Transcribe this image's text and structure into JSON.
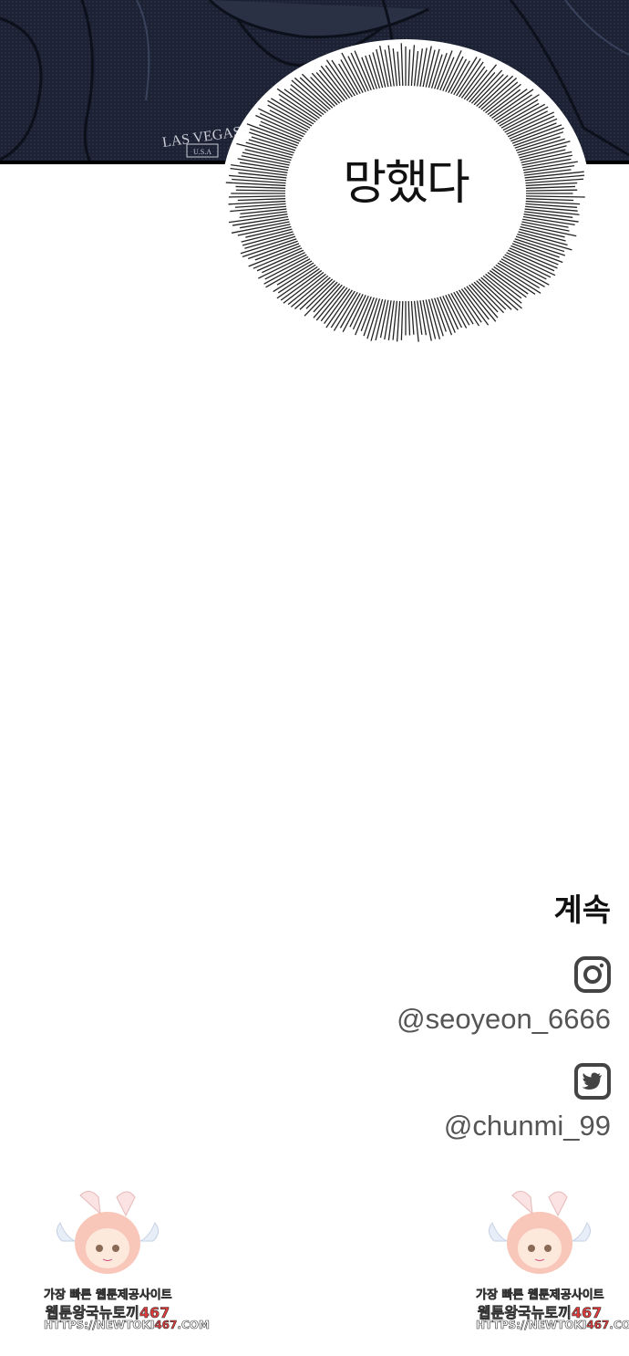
{
  "panel": {
    "shirt_text": "LAS VEGAS",
    "shirt_subtext": "U.S.A"
  },
  "bubble": {
    "text": "망했다"
  },
  "footer": {
    "continue_label": "계속",
    "instagram_icon": "instagram-icon",
    "instagram_handle": "@seoyeon_6666",
    "twitter_icon": "twitter-icon",
    "twitter_handle": "@chunmi_99"
  },
  "watermark": {
    "line1": "가장 빠른 웹툰제공사이트",
    "line2_prefix": "웹툰왕국뉴토끼",
    "line2_number": "467",
    "line3_prefix": "HTTPS://NEWTOKI",
    "line3_number": "467",
    "line3_suffix": ".COM"
  },
  "colors": {
    "panel_dark": "#1c2233",
    "accent_red": "#e23b3b"
  }
}
